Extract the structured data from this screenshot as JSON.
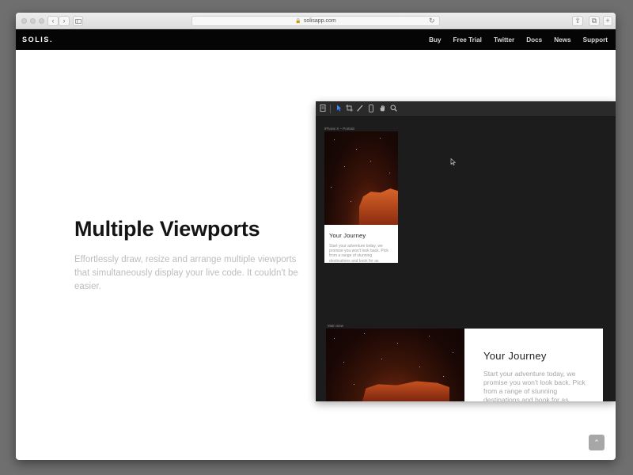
{
  "browser": {
    "url": "solisapp.com",
    "back_icon": "‹",
    "forward_icon": "›",
    "reload_icon": "↻",
    "share_icon": "⇪",
    "tabs_icon": "⧉",
    "new_tab_icon": "+"
  },
  "site": {
    "logo": "SOLIS.",
    "nav": [
      "Buy",
      "Free Trial",
      "Twitter",
      "Docs",
      "News",
      "Support"
    ]
  },
  "hero": {
    "title": "Multiple Viewports",
    "description": "Effortlessly draw, resize and arrange multiple viewports that simultaneously display your live code. It couldn't be easier."
  },
  "app_preview": {
    "tools": [
      "pages-icon",
      "pointer-icon",
      "frame-icon",
      "pen-icon",
      "device-icon",
      "hand-icon",
      "search-icon"
    ],
    "viewport_portrait": {
      "label": "iPhone X – Portrait",
      "heading": "Your Journey",
      "body": "Start your adventure today, we promise you won't look back. Pick from a range of stunning destinations and book for as"
    },
    "viewport_wide": {
      "label": "Main view",
      "heading": "Your Journey",
      "body": "Start your adventure today, we promise you won't look back. Pick from a range of stunning destinations and book for as"
    }
  },
  "scroll_top_icon": "⌃",
  "colors": {
    "nav_bg": "#050505",
    "app_bg": "#1c1c1c",
    "accent": "#3d8bff",
    "cliff": "#e26a2b"
  }
}
